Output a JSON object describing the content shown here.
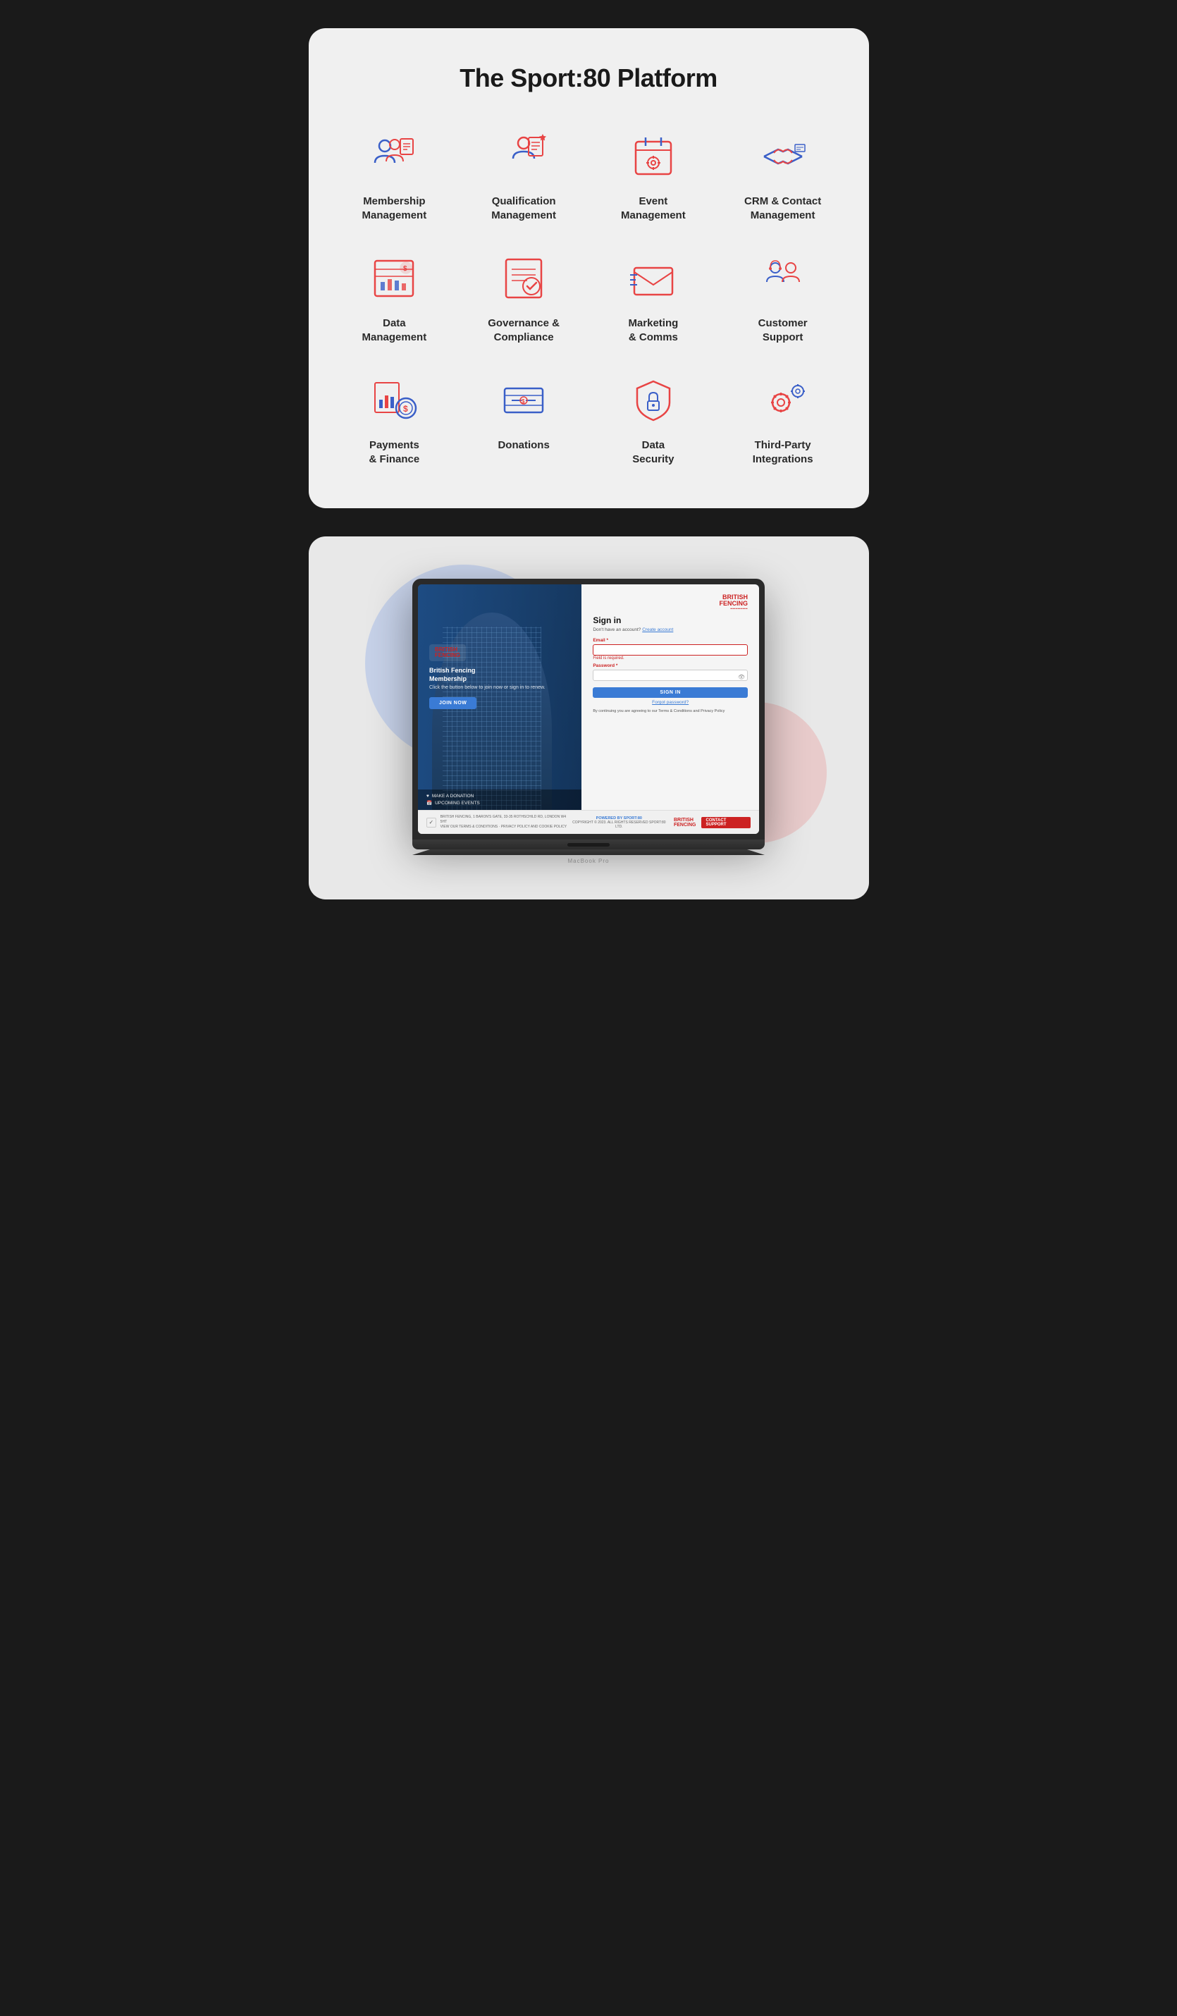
{
  "platform": {
    "title": "The Sport:80 Platform",
    "items": [
      {
        "id": "membership",
        "label": "Membership\nManagement",
        "icon": "membership"
      },
      {
        "id": "qualification",
        "label": "Qualification\nManagement",
        "icon": "qualification"
      },
      {
        "id": "event",
        "label": "Event\nManagement",
        "icon": "event"
      },
      {
        "id": "crm",
        "label": "CRM & Contact\nManagement",
        "icon": "crm"
      },
      {
        "id": "data",
        "label": "Data\nManagement",
        "icon": "data"
      },
      {
        "id": "governance",
        "label": "Governance &\nCompliance",
        "icon": "governance"
      },
      {
        "id": "marketing",
        "label": "Marketing\n& Comms",
        "icon": "marketing"
      },
      {
        "id": "support",
        "label": "Customer\nSupport",
        "icon": "support"
      },
      {
        "id": "payments",
        "label": "Payments\n& Finance",
        "icon": "payments"
      },
      {
        "id": "donations",
        "label": "Donations",
        "icon": "donations"
      },
      {
        "id": "security",
        "label": "Data\nSecurity",
        "icon": "security"
      },
      {
        "id": "integrations",
        "label": "Third-Party\nIntegrations",
        "icon": "integrations"
      }
    ]
  },
  "laptop": {
    "model_label": "MacBook Pro",
    "screen": {
      "left_title": "British Fencing\nMembership",
      "left_subtitle": "Click the button below to join now or sign in to renew.",
      "join_button": "JOIN NOW",
      "links": [
        "MAKE A DONATION",
        "UPCOMING EVENTS"
      ],
      "logo_text": "BRITISH\nFENCING"
    },
    "login": {
      "logo_line1": "BRITISH",
      "logo_line2": "FENCING",
      "title": "Sign in",
      "create_account_text": "Don't have an account?",
      "create_account_link": "Create account",
      "email_label": "Email *",
      "email_error": "Field is required.",
      "password_label": "Password *",
      "signin_button": "SIGN IN",
      "forgot_password": "Forgot password?",
      "terms_text": "By continuing you are agreeing to our Terms & Conditions and Privacy Policy"
    },
    "footer": {
      "address": "BRITISH FENCING, 1 BARON'S GATE, 33-35 ROTHSCHILD RD, LONDON W4 5HT\nVIEW OUR TERMS & CONDITIONS · PRIVACY POLICY AND COOKIE POLICY",
      "powered_by": "POWERED BY SPORT:80",
      "copyright": "COPYRIGHT © 2023. ALL RIGHTS RESERVED SPORT:80 LTD.",
      "bf_logo": "BRITISH\nFENCING",
      "contact_button": "CONTACT SUPPORT",
      "recaptcha": "✓"
    }
  }
}
